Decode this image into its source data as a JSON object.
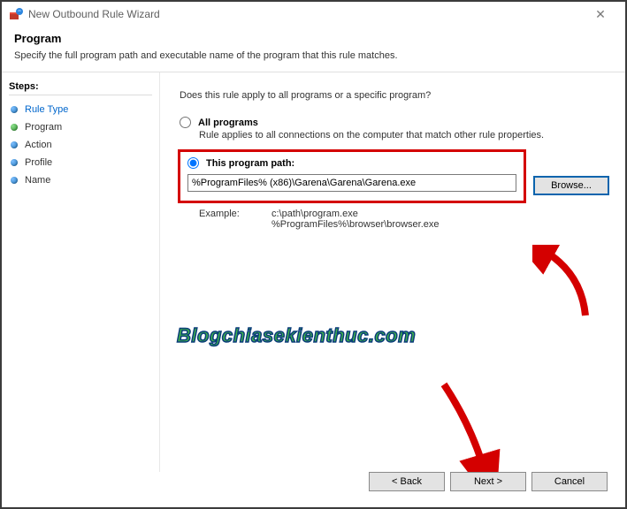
{
  "window": {
    "title": "New Outbound Rule Wizard"
  },
  "header": {
    "title": "Program",
    "subtitle": "Specify the full program path and executable name of the program that this rule matches."
  },
  "sidebar": {
    "title": "Steps:",
    "items": [
      {
        "label": "Rule Type",
        "active": true,
        "color": "blue"
      },
      {
        "label": "Program",
        "active": false,
        "color": "green"
      },
      {
        "label": "Action",
        "active": false,
        "color": "blue"
      },
      {
        "label": "Profile",
        "active": false,
        "color": "blue"
      },
      {
        "label": "Name",
        "active": false,
        "color": "blue"
      }
    ]
  },
  "main": {
    "question": "Does this rule apply to all programs or a specific program?",
    "all_programs": {
      "label": "All programs",
      "desc": "Rule applies to all connections on the computer that match other rule properties."
    },
    "this_path": {
      "label": "This program path:",
      "value": "%ProgramFiles% (x86)\\Garena\\Garena\\Garena.exe",
      "browse": "Browse..."
    },
    "example": {
      "label": "Example:",
      "line1": "c:\\path\\program.exe",
      "line2": "%ProgramFiles%\\browser\\browser.exe"
    }
  },
  "footer": {
    "back": "< Back",
    "next": "Next >",
    "cancel": "Cancel"
  },
  "watermark": "Blogchiasekienthuc.com"
}
